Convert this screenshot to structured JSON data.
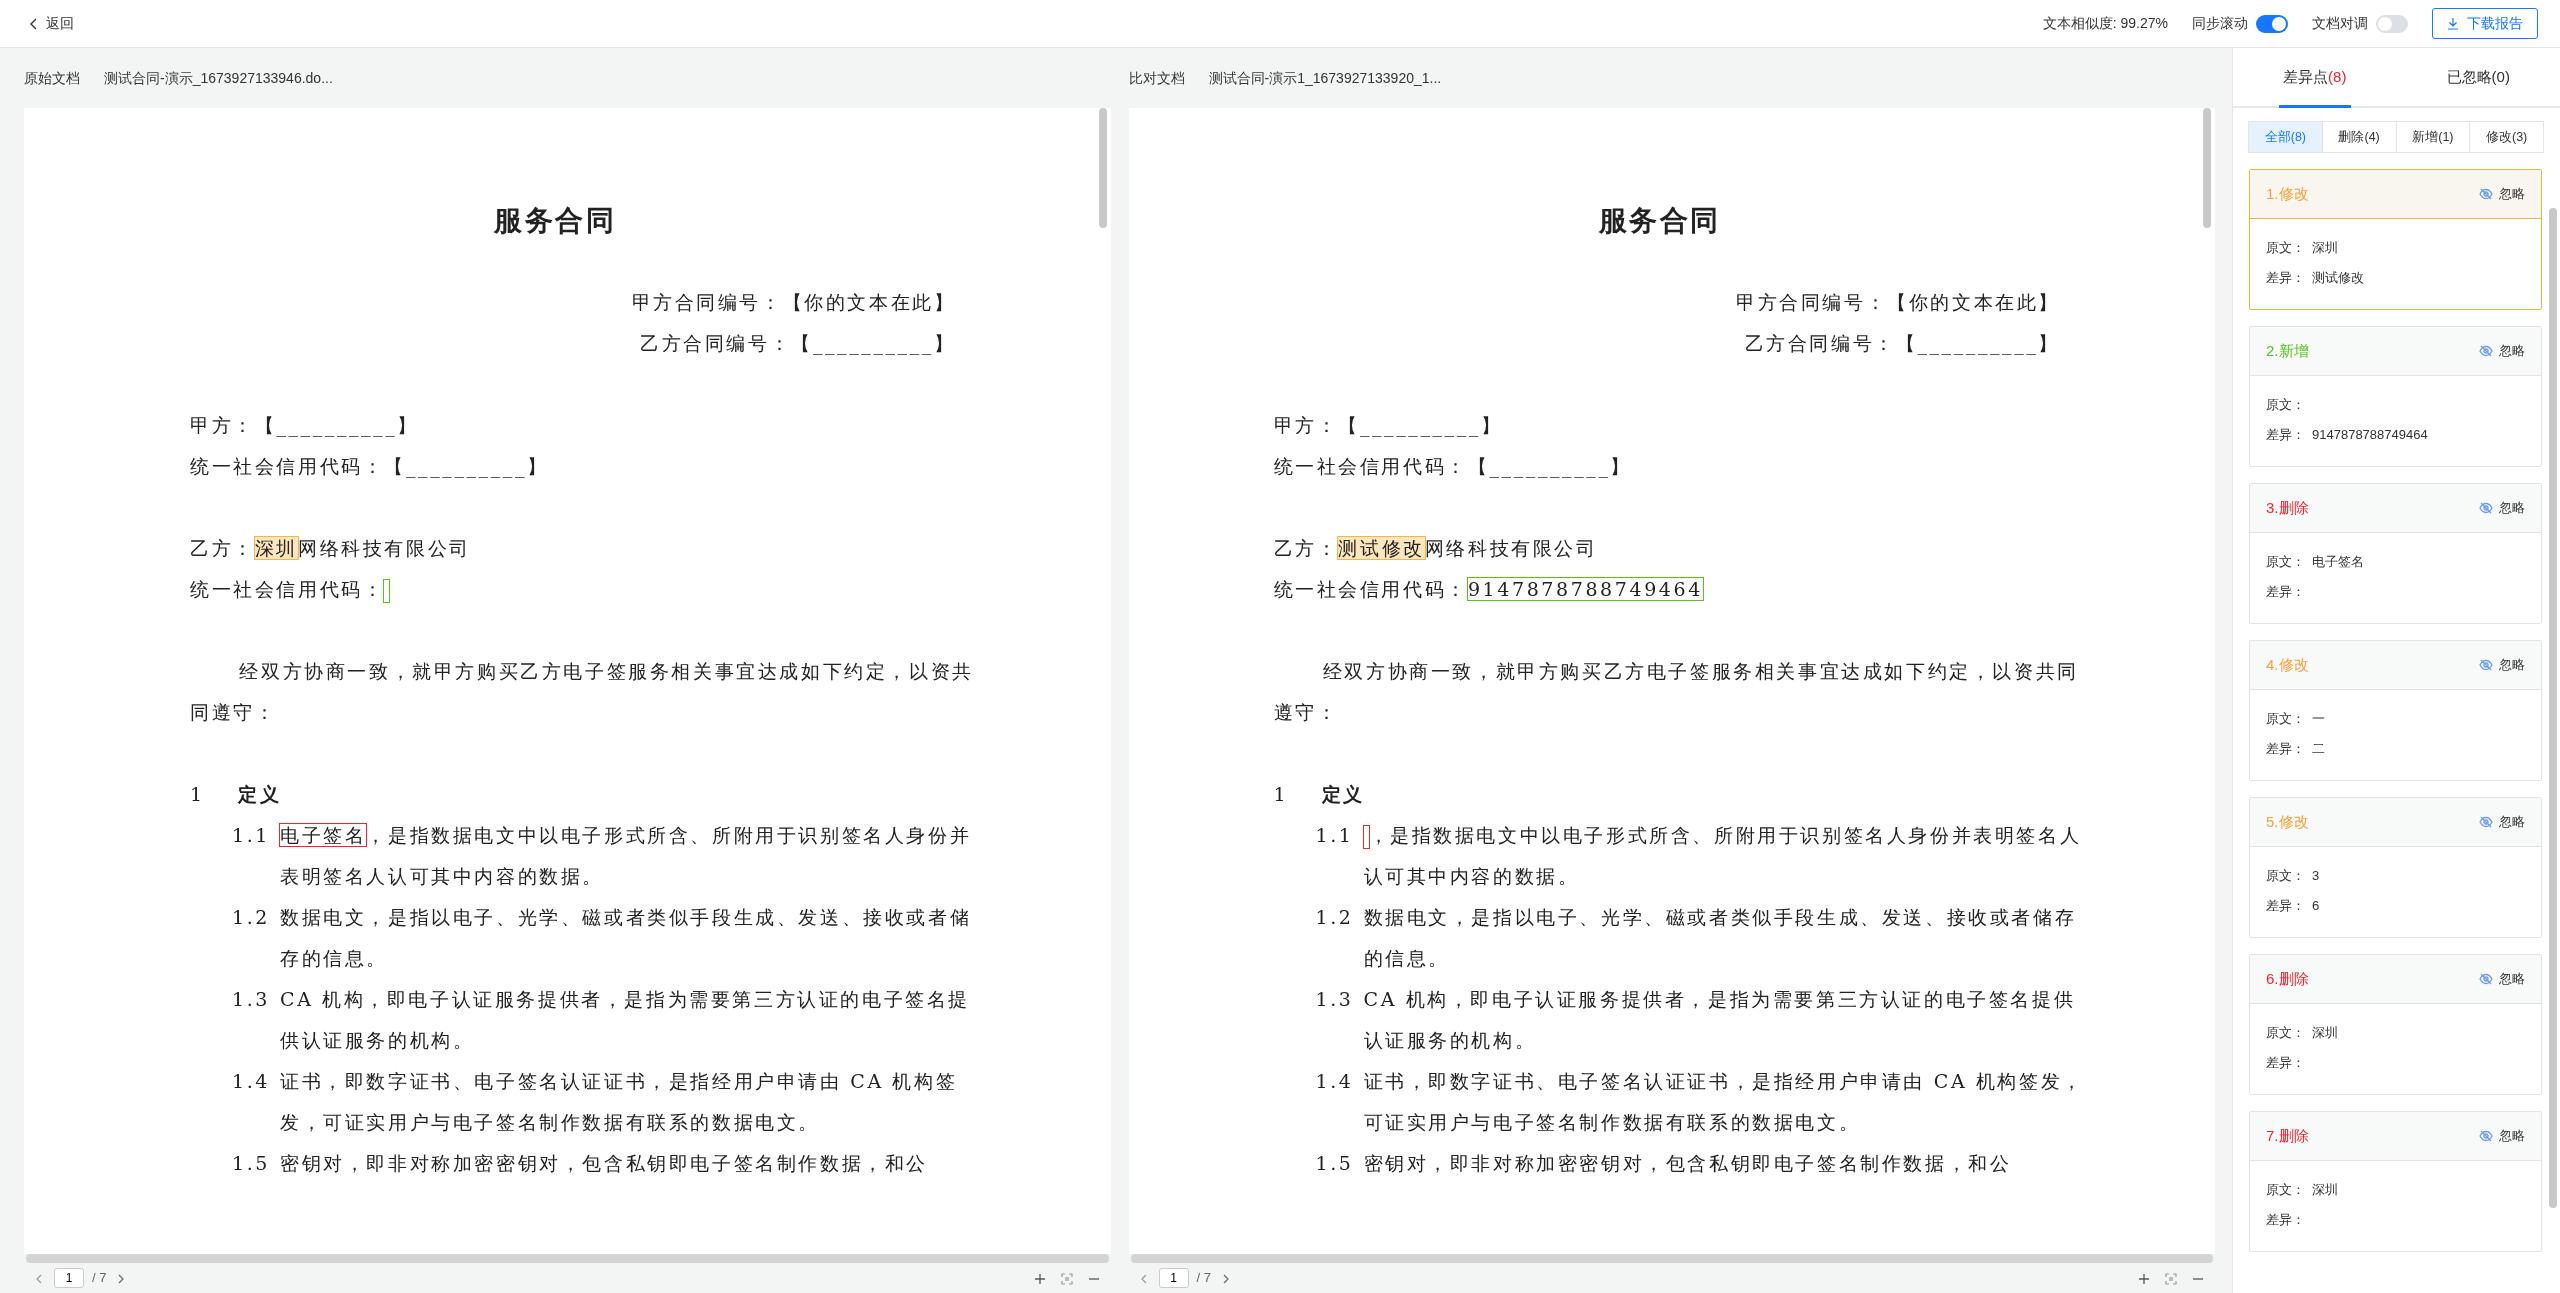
{
  "toolbar": {
    "back": "返回",
    "similarity": "文本相似度: 99.27%",
    "sync_scroll": {
      "label": "同步滚动",
      "on": true
    },
    "align_docs": {
      "label": "文档对调",
      "on": false
    },
    "download": "下载报告"
  },
  "documents": [
    {
      "type_label": "原始文档",
      "file_name": "测试合同-演示_1673927133946.do...",
      "page": "1",
      "page_total": "/ 7",
      "blocks": [
        [
          {
            "kind": "title",
            "segments": [
              {
                "text": "服务合同"
              }
            ]
          }
        ],
        [
          {
            "kind": "right",
            "segments": [
              {
                "text": "甲方合同编号：【你的文本在此】"
              }
            ]
          },
          {
            "kind": "right",
            "segments": [
              {
                "text": "乙方合同编号：【__________】"
              }
            ]
          }
        ],
        [
          {
            "kind": "line",
            "segments": [
              {
                "text": "甲方：【__________】"
              }
            ]
          },
          {
            "kind": "line",
            "segments": [
              {
                "text": "统一社会信用代码：【__________】"
              }
            ]
          }
        ],
        [
          {
            "kind": "line",
            "segments": [
              {
                "text": "乙方："
              },
              {
                "text": "深圳",
                "kind": "modify"
              },
              {
                "text": "网络科技有限公司"
              }
            ]
          },
          {
            "kind": "line",
            "segments": [
              {
                "text": "统一社会信用代码："
              },
              {
                "kind": "add"
              }
            ]
          }
        ],
        [
          {
            "kind": "para",
            "segments": [
              {
                "text": "经双方协商一致，就甲方购买乙方电子签服务相关事宜达成如下约定，以资共同遵守："
              }
            ]
          }
        ],
        [
          {
            "kind": "heading",
            "number": "1",
            "segments": [
              {
                "text": "定义"
              }
            ]
          },
          {
            "kind": "item",
            "number": "1.1",
            "segments": [
              {
                "text": "电子签名",
                "kind": "delete"
              },
              {
                "text": "，是指数据电文中以电子形式所含、所附用于识别签名人身份并表明签名人认可其中内容的数据。"
              }
            ]
          },
          {
            "kind": "item",
            "number": "1.2",
            "segments": [
              {
                "text": "数据电文，是指以电子、光学、磁或者类似手段生成、发送、接收或者储存的信息。"
              }
            ]
          },
          {
            "kind": "item",
            "number": "1.3",
            "segments": [
              {
                "text": "CA 机构，即电子认证服务提供者，是指为需要第三方认证的电子签名提供认证服务的机构。"
              }
            ]
          },
          {
            "kind": "item",
            "number": "1.4",
            "segments": [
              {
                "text": "证书，即数字证书、电子签名认证证书，是指经用户申请由 CA 机构签发，可证实用户与电子签名制作数据有联系的数据电文。"
              }
            ]
          },
          {
            "kind": "item",
            "number": "1.5",
            "segments": [
              {
                "text": "密钥对，即非对称加密密钥对，包含私钥即电子签名制作数据，和公"
              }
            ]
          }
        ]
      ]
    },
    {
      "type_label": "比对文档",
      "file_name": "测试合同-演示1_1673927133920_1...",
      "page": "1",
      "page_total": "/ 7",
      "blocks": [
        [
          {
            "kind": "title",
            "segments": [
              {
                "text": "服务合同"
              }
            ]
          }
        ],
        [
          {
            "kind": "right",
            "segments": [
              {
                "text": "甲方合同编号：【你的文本在此】"
              }
            ]
          },
          {
            "kind": "right",
            "segments": [
              {
                "text": "乙方合同编号：【__________】"
              }
            ]
          }
        ],
        [
          {
            "kind": "line",
            "segments": [
              {
                "text": "甲方：【__________】"
              }
            ]
          },
          {
            "kind": "line",
            "segments": [
              {
                "text": "统一社会信用代码：【__________】"
              }
            ]
          }
        ],
        [
          {
            "kind": "line",
            "segments": [
              {
                "text": "乙方："
              },
              {
                "text": "测试修改",
                "kind": "modify"
              },
              {
                "text": "网络科技有限公司"
              }
            ]
          },
          {
            "kind": "line",
            "segments": [
              {
                "text": "统一社会信用代码："
              },
              {
                "text": "9147878788749464",
                "kind": "add"
              }
            ]
          }
        ],
        [
          {
            "kind": "para",
            "segments": [
              {
                "text": "经双方协商一致，就甲方购买乙方电子签服务相关事宜达成如下约定，以资共同遵守："
              }
            ]
          }
        ],
        [
          {
            "kind": "heading",
            "number": "1",
            "segments": [
              {
                "text": "定义"
              }
            ]
          },
          {
            "kind": "item",
            "number": "1.1",
            "segments": [
              {
                "kind": "delete"
              },
              {
                "text": "，是指数据电文中以电子形式所含、所附用于识别签名人身份并表明签名人认可其中内容的数据。"
              }
            ]
          },
          {
            "kind": "item",
            "number": "1.2",
            "segments": [
              {
                "text": "数据电文，是指以电子、光学、磁或者类似手段生成、发送、接收或者储存的信息。"
              }
            ]
          },
          {
            "kind": "item",
            "number": "1.3",
            "segments": [
              {
                "text": "CA 机构，即电子认证服务提供者，是指为需要第三方认证的电子签名提供认证服务的机构。"
              }
            ]
          },
          {
            "kind": "item",
            "number": "1.4",
            "segments": [
              {
                "text": "证书，即数字证书、电子签名认证证书，是指经用户申请由 CA 机构签发，可证实用户与电子签名制作数据有联系的数据电文。"
              }
            ]
          },
          {
            "kind": "item",
            "number": "1.5",
            "segments": [
              {
                "text": "密钥对，即非对称加密密钥对，包含私钥即电子签名制作数据，和公"
              }
            ]
          }
        ]
      ]
    }
  ],
  "panel": {
    "tabs": [
      {
        "label": "差异点",
        "count": "(8)",
        "selected": true
      },
      {
        "label": "已忽略(0)",
        "selected": false
      }
    ],
    "filters": [
      {
        "label": "全部(8)",
        "selected": true
      },
      {
        "label": "删除(4)",
        "selected": false
      },
      {
        "label": "新增(1)",
        "selected": false
      },
      {
        "label": "修改(3)",
        "selected": false
      }
    ],
    "diffs": [
      {
        "kind": "modify",
        "title": "1.修改",
        "ignore": "忽略",
        "original_label": "原文：",
        "original": "深圳",
        "diff_label": "差异：",
        "diff": "测试修改",
        "selected": true
      },
      {
        "kind": "add",
        "title": "2.新增",
        "ignore": "忽略",
        "original_label": "原文：",
        "diff_label": "差异：",
        "diff": "9147878788749464",
        "selected": false
      },
      {
        "kind": "delete",
        "title": "3.删除",
        "ignore": "忽略",
        "original_label": "原文：",
        "original": "电子签名",
        "diff_label": "差异：",
        "selected": false
      },
      {
        "kind": "modify",
        "title": "4.修改",
        "ignore": "忽略",
        "original_label": "原文：",
        "original": "一",
        "diff_label": "差异：",
        "diff": "二",
        "selected": false
      },
      {
        "kind": "modify",
        "title": "5.修改",
        "ignore": "忽略",
        "original_label": "原文：",
        "original": "3",
        "diff_label": "差异：",
        "diff": "6",
        "selected": false
      },
      {
        "kind": "delete",
        "title": "6.删除",
        "ignore": "忽略",
        "original_label": "原文：",
        "original": "深圳",
        "diff_label": "差异：",
        "selected": false
      },
      {
        "kind": "delete",
        "title": "7.删除",
        "ignore": "忽略",
        "original_label": "原文：",
        "original": "深圳",
        "diff_label": "差异：",
        "selected": false
      }
    ]
  }
}
